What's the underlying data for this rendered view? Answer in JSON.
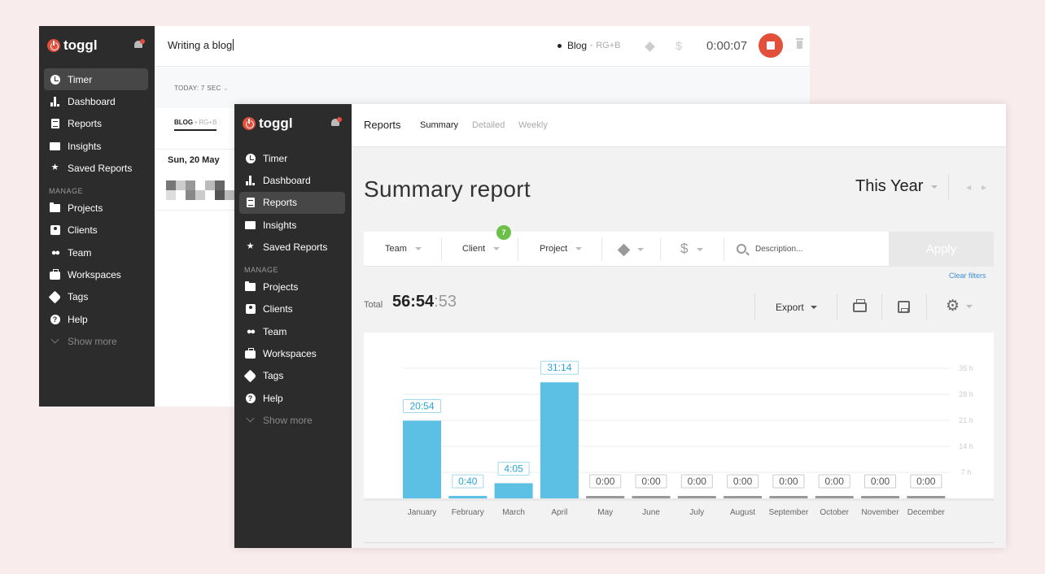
{
  "brand": {
    "name": "toggl"
  },
  "nav": {
    "items": [
      {
        "label": "Timer",
        "icon": "clock-icon"
      },
      {
        "label": "Dashboard",
        "icon": "bar-chart-icon"
      },
      {
        "label": "Reports",
        "icon": "document-icon"
      },
      {
        "label": "Insights",
        "icon": "insights-icon"
      },
      {
        "label": "Saved Reports",
        "icon": "star-icon"
      }
    ],
    "manage_label": "MANAGE",
    "manage_items": [
      {
        "label": "Projects",
        "icon": "folder-icon"
      },
      {
        "label": "Clients",
        "icon": "client-icon"
      },
      {
        "label": "Team",
        "icon": "team-icon"
      },
      {
        "label": "Workspaces",
        "icon": "briefcase-icon"
      },
      {
        "label": "Tags",
        "icon": "tag-icon"
      },
      {
        "label": "Help",
        "icon": "help-icon"
      }
    ],
    "show_more": "Show more"
  },
  "timer": {
    "description": "Writing a blog",
    "project": "Blog",
    "client": "RG+B",
    "duration": "0:00:07",
    "today_label": "TODAY: 7 SEC",
    "tab_project": "BLOG",
    "tab_client": "RG+B",
    "date": "Sun, 20 May"
  },
  "reports": {
    "header_title": "Reports",
    "tabs": [
      "Summary",
      "Detailed",
      "Weekly"
    ],
    "active_tab": "Summary",
    "title": "Summary report",
    "period": "This Year",
    "filters": {
      "team": "Team",
      "client": "Client",
      "client_badge": "7",
      "project": "Project",
      "description_placeholder": "Description...",
      "apply": "Apply",
      "clear": "Clear filters"
    },
    "total_label": "Total",
    "total_main": "56:54",
    "total_seconds": ":53",
    "export_label": "Export"
  },
  "colors": {
    "sidebar": "#2c2c2c",
    "accent_red": "#e24f3b",
    "bar_blue": "#5bc0e4",
    "badge_green": "#6cc04a",
    "link_blue": "#3b8fd9"
  },
  "chart_data": {
    "type": "bar",
    "categories": [
      "January",
      "February",
      "March",
      "April",
      "May",
      "June",
      "July",
      "August",
      "September",
      "October",
      "November",
      "December"
    ],
    "values_hours": [
      20.9,
      0.667,
      4.083,
      31.233,
      0,
      0,
      0,
      0,
      0,
      0,
      0,
      0
    ],
    "data_labels": [
      "20:54",
      "0:40",
      "4:05",
      "31:14",
      "0:00",
      "0:00",
      "0:00",
      "0:00",
      "0:00",
      "0:00",
      "0:00",
      "0:00"
    ],
    "y_ticks": [
      "7 h",
      "14 h",
      "21 h",
      "28 h",
      "35 h"
    ],
    "ylim": [
      0,
      35
    ],
    "grid": true
  }
}
